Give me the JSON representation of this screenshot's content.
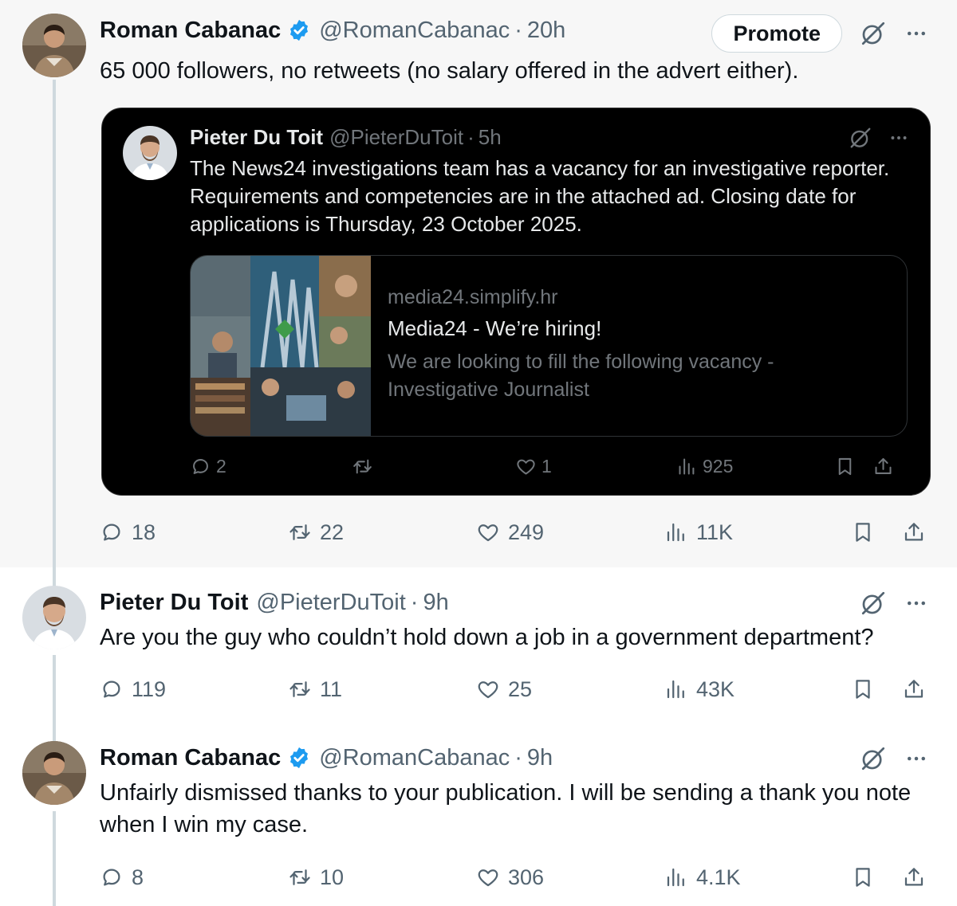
{
  "tweets": [
    {
      "name": "Roman Cabanac",
      "handle": "@RomanCabanac",
      "time": "20h",
      "promote_label": "Promote",
      "text": "65 000 followers, no retweets (no salary offered in the advert either).",
      "stats": {
        "replies": "18",
        "reposts": "22",
        "likes": "249",
        "views": "11K"
      },
      "quote": {
        "name": "Pieter Du Toit",
        "handle": "@PieterDuToit",
        "time": "5h",
        "text": "The News24 investigations team has a vacancy for an investigative reporter. Requirements and competencies are in the attached ad. Closing date for applications is Thursday, 23 October 2025.",
        "link": {
          "domain": "media24.simplify.hr",
          "title": "Media24 - We’re hiring!",
          "description": "We are looking to fill the following vacancy - Investigative Journalist"
        },
        "stats": {
          "replies": "2",
          "reposts": "",
          "likes": "1",
          "views": "925"
        }
      }
    },
    {
      "name": "Pieter Du Toit",
      "handle": "@PieterDuToit",
      "time": "9h",
      "text": "Are you the guy who couldn’t hold down a job in a government department?",
      "stats": {
        "replies": "119",
        "reposts": "11",
        "likes": "25",
        "views": "43K"
      }
    },
    {
      "name": "Roman Cabanac",
      "handle": "@RomanCabanac",
      "time": "9h",
      "text": "Unfairly dismissed thanks to your publication. I will be sending a thank you note when I win my case.",
      "stats": {
        "replies": "8",
        "reposts": "10",
        "likes": "306",
        "views": "4.1K"
      }
    }
  ],
  "separator": "·",
  "colors": {
    "verified": "#1d9bf0",
    "secondary_text": "#536471",
    "quote_bg": "#000000"
  },
  "icons": [
    "verified-badge-icon",
    "grok-icon",
    "more-icon",
    "reply-icon",
    "repost-icon",
    "like-icon",
    "views-icon",
    "bookmark-icon",
    "share-icon"
  ]
}
